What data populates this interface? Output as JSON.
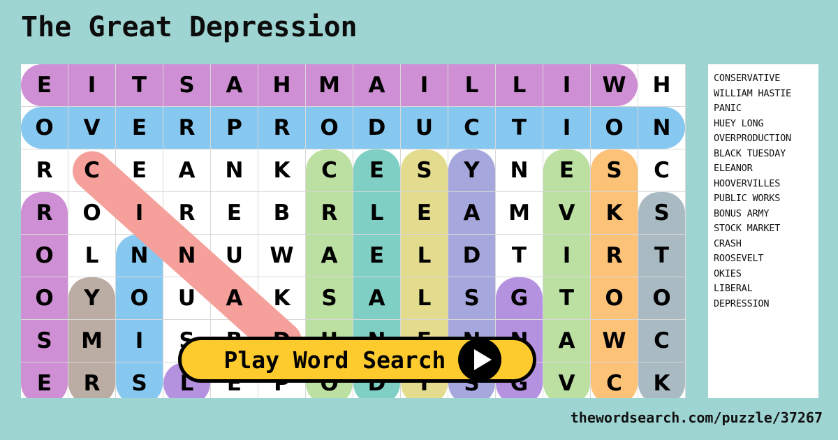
{
  "title": "The Great Depression",
  "footer": {
    "url": "thewordsearch.com/puzzle/37267"
  },
  "play_button": {
    "label": "Play Word Search",
    "icon": "play-triangle-icon"
  },
  "colors": {
    "background": "#9ed5d3",
    "panel": "#ffffff",
    "grid_line": "#d8d8d8",
    "button_fill": "#fecb2e",
    "button_border": "#000000",
    "orchid": "#cf8fd4",
    "sky": "#87c8f0",
    "salmon": "#f5a09a",
    "lightgreen": "#bcdfa2",
    "teal": "#7fcfc4",
    "khaki": "#e3dc8e",
    "periwinkle": "#a6a7dc",
    "orange": "#fcc277",
    "slate": "#a9bac3",
    "taupe": "#bbada4",
    "violet": "#b592e0"
  },
  "word_list": [
    "CONSERVATIVE",
    "WILLIAM HASTIE",
    "PANIC",
    "HUEY LONG",
    "OVERPRODUCTION",
    "BLACK TUESDAY",
    "ELEANOR",
    "HOOVERVILLES",
    "PUBLIC WORKS",
    "BONUS ARMY",
    "STOCK MARKET",
    "CRASH",
    "ROOSEVELT",
    "OKIES",
    "LIBERAL",
    "DEPRESSION"
  ],
  "grid": {
    "columns": 14,
    "rows": 8,
    "letters": [
      [
        "E",
        "I",
        "T",
        "S",
        "A",
        "H",
        "M",
        "A",
        "I",
        "L",
        "L",
        "I",
        "W",
        "H"
      ],
      [
        "O",
        "V",
        "E",
        "R",
        "P",
        "R",
        "O",
        "D",
        "U",
        "C",
        "T",
        "I",
        "O",
        "N"
      ],
      [
        "R",
        "C",
        "E",
        "A",
        "N",
        "K",
        "C",
        "E",
        "S",
        "Y",
        "N",
        "E",
        "S",
        "C"
      ],
      [
        "R",
        "O",
        "I",
        "R",
        "E",
        "B",
        "R",
        "L",
        "E",
        "A",
        "M",
        "V",
        "K",
        "S"
      ],
      [
        "O",
        "L",
        "N",
        "N",
        "U",
        "W",
        "A",
        "E",
        "L",
        "D",
        "T",
        "I",
        "R",
        "T"
      ],
      [
        "O",
        "Y",
        "O",
        "U",
        "A",
        "K",
        "S",
        "A",
        "L",
        "S",
        "G",
        "T",
        "O",
        "O"
      ],
      [
        "S",
        "M",
        "I",
        "S",
        "B",
        "D",
        "U",
        "N",
        "E",
        "N",
        "N",
        "A",
        "W",
        "C"
      ],
      [
        "E",
        "R",
        "S",
        "L",
        "E",
        "P",
        "O",
        "D",
        "T",
        "S",
        "G",
        "V",
        "C",
        "K"
      ]
    ],
    "highlights": [
      {
        "word": "WILLIAM HASTIE",
        "color": "#cf8fd4",
        "dir": "horizontal",
        "row": 0,
        "col": 0,
        "len": 13
      },
      {
        "word": "OVERPRODUCTION",
        "color": "#87c8f0",
        "dir": "horizontal",
        "row": 1,
        "col": 0,
        "len": 14
      },
      {
        "word": "CRASH",
        "color": "#f5a09a",
        "dir": "diagonal",
        "row": 2,
        "col": 1,
        "len": 5
      },
      {
        "word": "ROOSEVELT",
        "color": "#cf8fd4",
        "dir": "vertical",
        "row": 3,
        "col": 0,
        "len": 5
      },
      {
        "word": "BONUS ARMY",
        "color": "#bbada4",
        "dir": "vertical",
        "row": 5,
        "col": 1,
        "len": 3
      },
      {
        "word": "HUEY LONG",
        "color": "#87c8f0",
        "dir": "vertical",
        "row": 4,
        "col": 2,
        "len": 4
      },
      {
        "word": "LIBERAL",
        "color": "#b592e0",
        "dir": "vertical",
        "row": 7,
        "col": 3,
        "len": 1
      },
      {
        "word": "PUBLIC WORKS",
        "color": "#bcdfa2",
        "dir": "vertical",
        "row": 2,
        "col": 6,
        "len": 6
      },
      {
        "word": "ELEANOR",
        "color": "#7fcfc4",
        "dir": "vertical",
        "row": 2,
        "col": 7,
        "len": 6
      },
      {
        "word": "HOOVERVILLES",
        "color": "#e3dc8e",
        "dir": "vertical",
        "row": 2,
        "col": 8,
        "len": 6
      },
      {
        "word": "BLACK TUESDAY",
        "color": "#a6a7dc",
        "dir": "vertical",
        "row": 2,
        "col": 9,
        "len": 6
      },
      {
        "word": "DEPRESSION",
        "color": "#b592e0",
        "dir": "vertical",
        "row": 5,
        "col": 10,
        "len": 3
      },
      {
        "word": "CONSERVATIVE",
        "color": "#bcdfa2",
        "dir": "vertical",
        "row": 2,
        "col": 11,
        "len": 6
      },
      {
        "word": "PANIC",
        "color": "#fcc277",
        "dir": "vertical",
        "row": 2,
        "col": 12,
        "len": 6
      },
      {
        "word": "STOCK MARKET",
        "color": "#a9bac3",
        "dir": "vertical",
        "row": 3,
        "col": 13,
        "len": 5
      }
    ]
  }
}
